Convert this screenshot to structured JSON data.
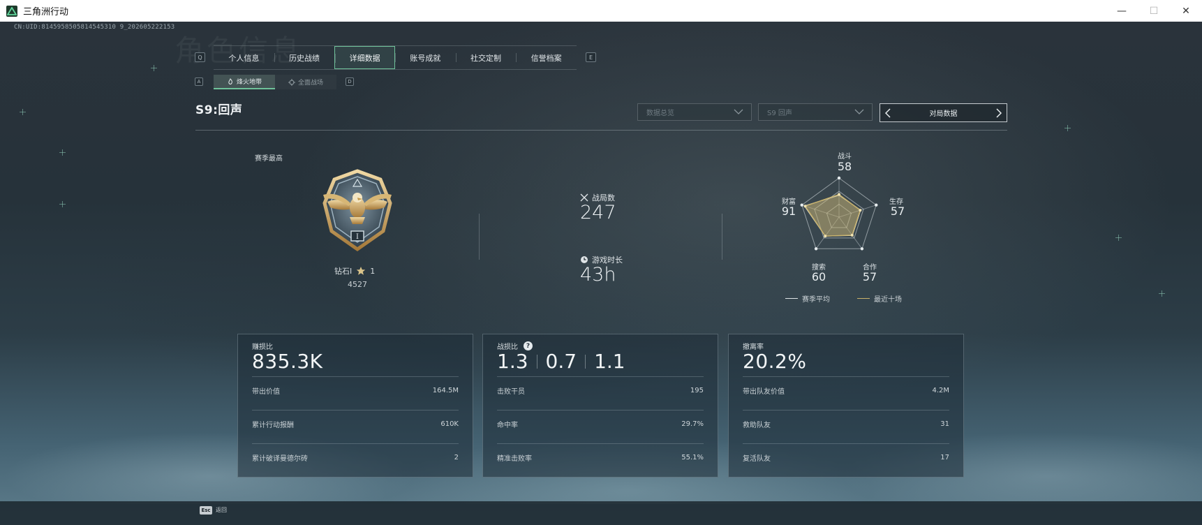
{
  "window": {
    "title": "三角洲行动",
    "minimize": "—",
    "maximize": "☐",
    "close": "✕"
  },
  "uid": "CN:UID:8145958505814545310 9_202605222153",
  "ghost_title": "角色信息",
  "keyhints": {
    "tabs_left": "Q",
    "tabs_right": "E",
    "sub_left": "A",
    "sub_right": "D"
  },
  "tabs": [
    {
      "label": "个人信息"
    },
    {
      "label": "历史战绩"
    },
    {
      "label": "详细数据",
      "active": true
    },
    {
      "label": "账号成就"
    },
    {
      "label": "社交定制"
    },
    {
      "label": "信誉档案"
    }
  ],
  "sub_tabs": [
    {
      "label": "烽火地带",
      "icon": "flame-icon",
      "active": true
    },
    {
      "label": "全面战场",
      "icon": "crosshair-icon",
      "active": false
    }
  ],
  "season": {
    "title": "S9:回声",
    "dropdown_overview": "数据总览",
    "dropdown_season": "S9 回声",
    "match_data_button": "对局数据"
  },
  "rank": {
    "season_best_label": "赛季最高",
    "name": "钻石I",
    "stars": "1",
    "score": "4527"
  },
  "stats": {
    "battles_label": "战局数",
    "battles_value": "247",
    "playtime_label": "游戏时长",
    "playtime_value": "43h"
  },
  "radar": {
    "axes": [
      {
        "label": "战斗",
        "value": "58"
      },
      {
        "label": "生存",
        "value": "57"
      },
      {
        "label": "合作",
        "value": "57"
      },
      {
        "label": "搜索",
        "value": "60"
      },
      {
        "label": "财富",
        "value": "91"
      }
    ],
    "season_avg_fractions": [
      0.56,
      0.58,
      0.58,
      0.6,
      0.93
    ],
    "last_ten_fractions": [
      0.58,
      0.57,
      0.57,
      0.6,
      0.91
    ],
    "legend_season_avg": "赛季平均",
    "legend_last_ten": "最近十场",
    "colors": {
      "season_avg": "#dfe5e8",
      "last_ten": "#c9b26a"
    }
  },
  "cards": {
    "profit": {
      "title": "赚损比",
      "value": "835.3K",
      "rows": [
        {
          "label": "带出价值",
          "value": "164.5M"
        },
        {
          "label": "累计行动报酬",
          "value": "610K"
        },
        {
          "label": "累计破译曼德尔砖",
          "value": "2"
        }
      ]
    },
    "kd": {
      "title": "战损比",
      "help": "?",
      "values": [
        "1.3",
        "0.7",
        "1.1"
      ],
      "rows": [
        {
          "label": "击败干员",
          "value": "195"
        },
        {
          "label": "命中率",
          "value": "29.7%"
        },
        {
          "label": "精准击败率",
          "value": "55.1%"
        }
      ]
    },
    "extract": {
      "title": "撤离率",
      "value": "20.2%",
      "rows": [
        {
          "label": "带出队友价值",
          "value": "4.2M"
        },
        {
          "label": "救助队友",
          "value": "31"
        },
        {
          "label": "复活队友",
          "value": "17"
        }
      ]
    }
  },
  "footer": {
    "esc_key": "Esc",
    "back_label": "返回"
  }
}
